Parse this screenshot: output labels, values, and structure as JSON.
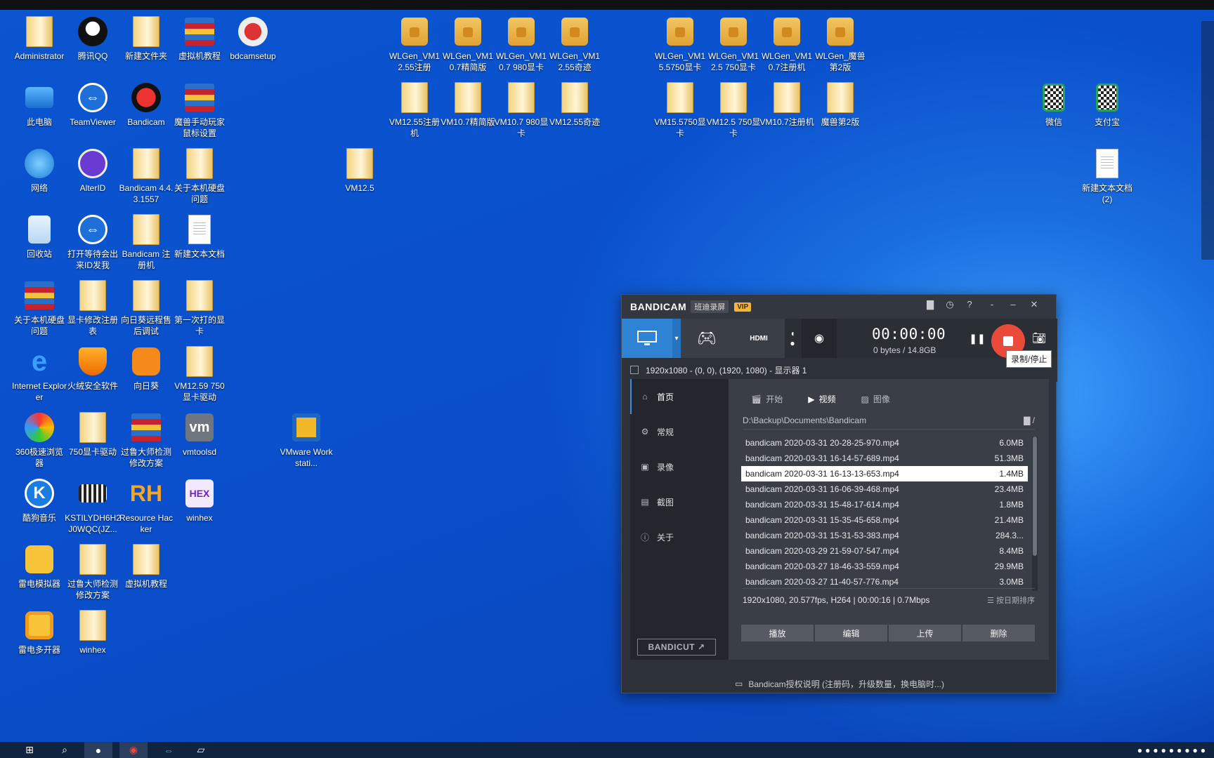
{
  "desktop": {
    "icons": [
      {
        "label": "Administrator",
        "icon": "user-folder-icon"
      },
      {
        "label": "腾讯QQ",
        "icon": "qq-icon"
      },
      {
        "label": "新建文件夹",
        "icon": "folder-icon"
      },
      {
        "label": "虚拟机教程",
        "icon": "winrar-icon"
      },
      {
        "label": "bdcamsetup",
        "icon": "installer-icon"
      },
      {
        "label": "此电脑",
        "icon": "computer-icon"
      },
      {
        "label": "TeamViewer",
        "icon": "teamviewer-icon"
      },
      {
        "label": "Bandicam",
        "icon": "bandicam-icon"
      },
      {
        "label": "魔兽手动玩家鼠标设置",
        "icon": "winrar-icon"
      },
      {
        "label": "网络",
        "icon": "network-icon"
      },
      {
        "label": "AlterID",
        "icon": "alterid-icon"
      },
      {
        "label": "Bandicam 4.4.3.1557",
        "icon": "folder-icon"
      },
      {
        "label": "关于本机硬盘问题",
        "icon": "folder-icon"
      },
      {
        "label": "回收站",
        "icon": "recycle-bin-icon"
      },
      {
        "label": "打开等待会出来ID发我",
        "icon": "teamviewer-icon"
      },
      {
        "label": "Bandicam 注册机",
        "icon": "folder-icon"
      },
      {
        "label": "新建文本文档",
        "icon": "text-document-icon"
      },
      {
        "label": "关于本机硬盘问题",
        "icon": "winrar-icon"
      },
      {
        "label": "显卡修改注册表",
        "icon": "folder-icon"
      },
      {
        "label": "向日葵远程售后调试",
        "icon": "folder-icon"
      },
      {
        "label": "第一次打的显卡",
        "icon": "folder-icon"
      },
      {
        "label": "Internet Explorer",
        "icon": "internet-explorer-icon"
      },
      {
        "label": "火绒安全软件",
        "icon": "huorong-icon"
      },
      {
        "label": "向日葵",
        "icon": "sunflower-icon"
      },
      {
        "label": "VM12.59 750显卡驱动",
        "icon": "folder-icon"
      },
      {
        "label": "360极速浏览器",
        "icon": "360-browser-icon"
      },
      {
        "label": "750显卡驱动",
        "icon": "folder-icon"
      },
      {
        "label": "过鲁大师检测修改方案",
        "icon": "winrar-icon"
      },
      {
        "label": "vmtoolsd",
        "icon": "vm-icon"
      },
      {
        "label": "酷狗音乐",
        "icon": "kugou-icon"
      },
      {
        "label": "KSTILYDH6H2J0WQC(JZ...",
        "icon": "image-file-icon"
      },
      {
        "label": "Resource Hacker",
        "icon": "resource-hacker-icon"
      },
      {
        "label": "winhex",
        "icon": "winhex-icon"
      },
      {
        "label": "雷电模拟器",
        "icon": "leidian-icon"
      },
      {
        "label": "过鲁大师检测修改方案",
        "icon": "folder-icon"
      },
      {
        "label": "虚拟机教程",
        "icon": "folder-icon"
      },
      {
        "label": "雷电多开器",
        "icon": "leidian-multi-icon"
      },
      {
        "label": "winhex",
        "icon": "folder-icon"
      },
      {
        "label": "VM12.5",
        "icon": "folder-icon"
      },
      {
        "label": "VMware Workstati...",
        "icon": "vmware-icon"
      },
      {
        "label": "WLGen_VM12.55注册",
        "icon": "lock-folder-icon"
      },
      {
        "label": "WLGen_VM10.7精简版",
        "icon": "lock-folder-icon"
      },
      {
        "label": "WLGen_VM10.7 980显卡",
        "icon": "lock-folder-icon"
      },
      {
        "label": "WLGen_VM12.55奇迹",
        "icon": "lock-folder-icon"
      },
      {
        "label": "VM12.55注册机",
        "icon": "folder-icon"
      },
      {
        "label": "VM10.7精简版",
        "icon": "folder-icon"
      },
      {
        "label": "VM10.7 980显卡",
        "icon": "folder-icon"
      },
      {
        "label": "VM12.55奇迹",
        "icon": "folder-icon"
      },
      {
        "label": "WLGen_VM15.5750显卡",
        "icon": "lock-folder-icon"
      },
      {
        "label": "WLGen_VM12.5 750显卡",
        "icon": "lock-folder-icon"
      },
      {
        "label": "WLGen_VM10.7注册机",
        "icon": "lock-folder-icon"
      },
      {
        "label": "WLGen_魔兽第2版",
        "icon": "lock-folder-icon"
      },
      {
        "label": "VM15.5750显卡",
        "icon": "folder-icon"
      },
      {
        "label": "VM12.5 750显卡",
        "icon": "folder-icon"
      },
      {
        "label": "VM10.7注册机",
        "icon": "folder-icon"
      },
      {
        "label": "魔兽第2版",
        "icon": "folder-icon"
      },
      {
        "label": "微信",
        "icon": "qr-code-icon"
      },
      {
        "label": "支付宝",
        "icon": "qr-code-icon"
      },
      {
        "label": "新建文本文档 (2)",
        "icon": "text-document-icon"
      }
    ]
  },
  "bandicam": {
    "brand": "BANDICAM",
    "brand_tag": "班迪录屏",
    "vip": "VIP",
    "timer": "00:00:00",
    "bytes": "0 bytes / 14.8GB",
    "tooltip": "录制/停止",
    "resolution": "1920x1080 - (0, 0), (1920, 1080) - 显示器 1",
    "sidebar": [
      "首页",
      "常规",
      "录像",
      "截图",
      "关于"
    ],
    "bandicut": "BANDICUT ↗",
    "tabs": [
      "开始",
      "视频",
      "图像"
    ],
    "path": "D:\\Backup\\Documents\\Bandicam",
    "files": [
      {
        "name": "bandicam 2020-03-31 20-28-25-970.mp4",
        "size": "6.0MB"
      },
      {
        "name": "bandicam 2020-03-31 16-14-57-689.mp4",
        "size": "51.3MB"
      },
      {
        "name": "bandicam 2020-03-31 16-13-13-653.mp4",
        "size": "1.4MB"
      },
      {
        "name": "bandicam 2020-03-31 16-06-39-468.mp4",
        "size": "23.4MB"
      },
      {
        "name": "bandicam 2020-03-31 15-48-17-614.mp4",
        "size": "1.8MB"
      },
      {
        "name": "bandicam 2020-03-31 15-35-45-658.mp4",
        "size": "21.4MB"
      },
      {
        "name": "bandicam 2020-03-31 15-31-53-383.mp4",
        "size": "284.3..."
      },
      {
        "name": "bandicam 2020-03-29 21-59-07-547.mp4",
        "size": "8.4MB"
      },
      {
        "name": "bandicam 2020-03-27 18-46-33-559.mp4",
        "size": "29.9MB"
      },
      {
        "name": "bandicam 2020-03-27 11-40-57-776.mp4",
        "size": "3.0MB"
      }
    ],
    "info": "1920x1080, 20.577fps, H264 | 00:00:16 | 0.7Mbps",
    "sort": "☰ 按日期排序",
    "actions": [
      "播放",
      "编辑",
      "上传",
      "删除"
    ],
    "footer": "Bandicam授权说明 (注册码，升级数量，换电脑时...)"
  },
  "colors": {
    "accent": "#3a8ee0",
    "record": "#ea4a3a",
    "vip": "#f3b43a"
  }
}
